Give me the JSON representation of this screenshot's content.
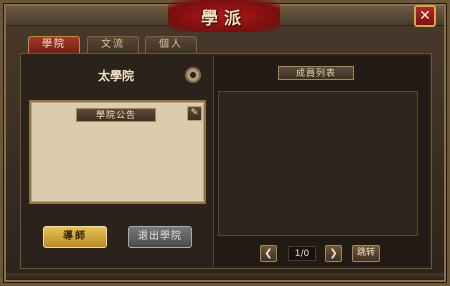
{
  "window": {
    "title": "學派",
    "close_icon": "close-icon"
  },
  "tabs": [
    {
      "label": "學院",
      "active": true
    },
    {
      "label": "文流",
      "active": false
    },
    {
      "label": "個人",
      "active": false
    }
  ],
  "academy": {
    "name": "太學院",
    "settings_icon": "gear-icon",
    "notice_title": "學院公告",
    "notice_text": "",
    "edit_icon": "pencil-icon"
  },
  "actions": {
    "mentor_label": "導師",
    "leave_label": "退出學院"
  },
  "members": {
    "title": "成員列表",
    "items": []
  },
  "pager": {
    "prev_icon": "chevron-left-icon",
    "next_icon": "chevron-right-icon",
    "page": "1/0",
    "jump_label": "跳转"
  },
  "colors": {
    "accent_red": "#b01818",
    "gold": "#e7c35a",
    "parchment": "#d9cbab"
  }
}
